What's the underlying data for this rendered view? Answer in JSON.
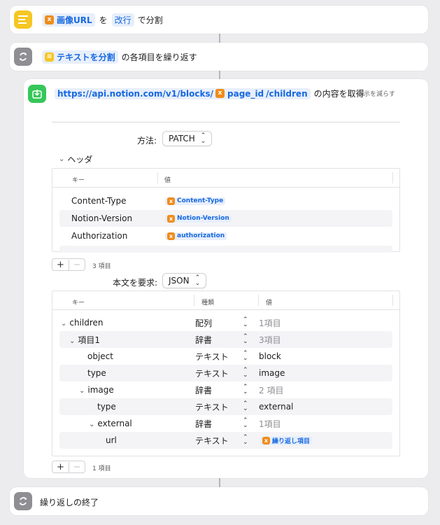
{
  "step1": {
    "var_token": "画像URL",
    "text_wo": "を",
    "sep_token": "改行",
    "text_action": "で分割"
  },
  "step2": {
    "var_token": "テキストを分割",
    "text_action": "の各項目を繰り返す"
  },
  "step3": {
    "url_part1": "https://api.notion.com/v1/blocks/",
    "url_var": "page_id",
    "url_part2": "/children",
    "text_action": "の内容を取得",
    "show_less": "表示を減らす",
    "method_label": "方法:",
    "method_value": "PATCH",
    "headers_label": "ヘッダ",
    "headers_table": {
      "col_key": "キー",
      "col_value": "値",
      "rows": [
        {
          "key": "Content-Type",
          "value": "Content-Type"
        },
        {
          "key": "Notion-Version",
          "value": "Notion-Version"
        },
        {
          "key": "Authorization",
          "value": "authorization"
        }
      ],
      "count": "3 項目"
    },
    "body_label": "本文を要求:",
    "body_value": "JSON",
    "body_table": {
      "col_key": "キー",
      "col_type": "種類",
      "col_value": "値",
      "rows": [
        {
          "key": "children",
          "type": "配列",
          "value": "1項目",
          "muted": true
        },
        {
          "key": "項目1",
          "type": "辞書",
          "value": "3項目",
          "muted": true
        },
        {
          "key": "object",
          "type": "テキスト",
          "value": "block",
          "muted": false
        },
        {
          "key": "type",
          "type": "テキスト",
          "value": "image",
          "muted": false
        },
        {
          "key": "image",
          "type": "辞書",
          "value": "2 項目",
          "muted": true
        },
        {
          "key": "type",
          "type": "テキスト",
          "value": "external",
          "muted": false
        },
        {
          "key": "external",
          "type": "辞書",
          "value": "1項目",
          "muted": true
        },
        {
          "key": "url",
          "type": "テキスト",
          "value": "繰り返し項目",
          "muted": false
        }
      ],
      "count": "1 項目"
    }
  },
  "step4": {
    "text": "繰り返しの終了"
  },
  "controls": {
    "plus": "+",
    "minus": "−",
    "badge_x": "x"
  }
}
